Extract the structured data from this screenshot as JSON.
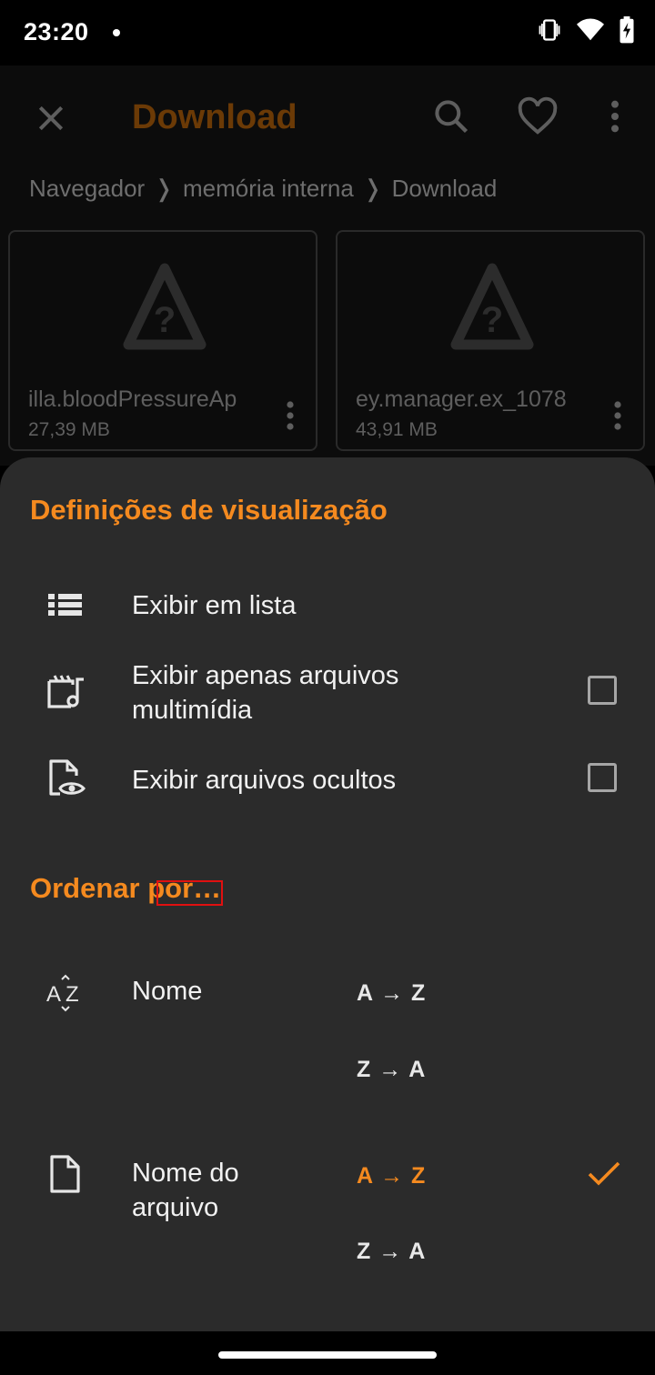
{
  "status_bar": {
    "time": "23:20",
    "icons": [
      "vibrate-icon",
      "wifi-icon",
      "battery-charging-icon"
    ]
  },
  "app_bar": {
    "title": "Download",
    "title_color": "#6b3a06",
    "actions": [
      "close-icon",
      "search-icon",
      "heart-icon",
      "more-vert-icon"
    ]
  },
  "breadcrumb": {
    "items": [
      "Navegador",
      "memória interna",
      "Download"
    ]
  },
  "files": [
    {
      "name": "illa.bloodPressureAp",
      "size": "27,39 MB",
      "icon": "warning-unknown-icon"
    },
    {
      "name": "ey.manager.ex_1078",
      "size": "43,91 MB",
      "icon": "warning-unknown-icon"
    }
  ],
  "sheet": {
    "view_title": "Definições de visualização",
    "view_options": [
      {
        "label": "Exibir em lista",
        "icon": "list-icon",
        "has_checkbox": false
      },
      {
        "label_line1": "Exibir apenas arquivos",
        "label_line2": "multimídia",
        "icon": "media-file-icon",
        "has_checkbox": true,
        "checked": false
      },
      {
        "label": "Exibir arquivos ocultos",
        "icon": "hidden-file-icon",
        "has_checkbox": true,
        "checked": false
      }
    ],
    "sort_title": "Ordenar por…",
    "sort_title_part1": "Ordenar",
    "sort_title_part2": "por…",
    "sort_options": [
      {
        "label": "Nome",
        "icon": "sort-az-icon",
        "asc": "A → Z",
        "desc": "Z → A",
        "selected": null
      },
      {
        "label_line1": "Nome do",
        "label_line2": "arquivo",
        "icon": "file-icon",
        "asc": "A → Z",
        "desc": "Z → A",
        "selected": "asc"
      }
    ]
  },
  "colors": {
    "accent": "#f58a1f",
    "sheet_bg": "#2b2b2b",
    "background": "#000000"
  }
}
